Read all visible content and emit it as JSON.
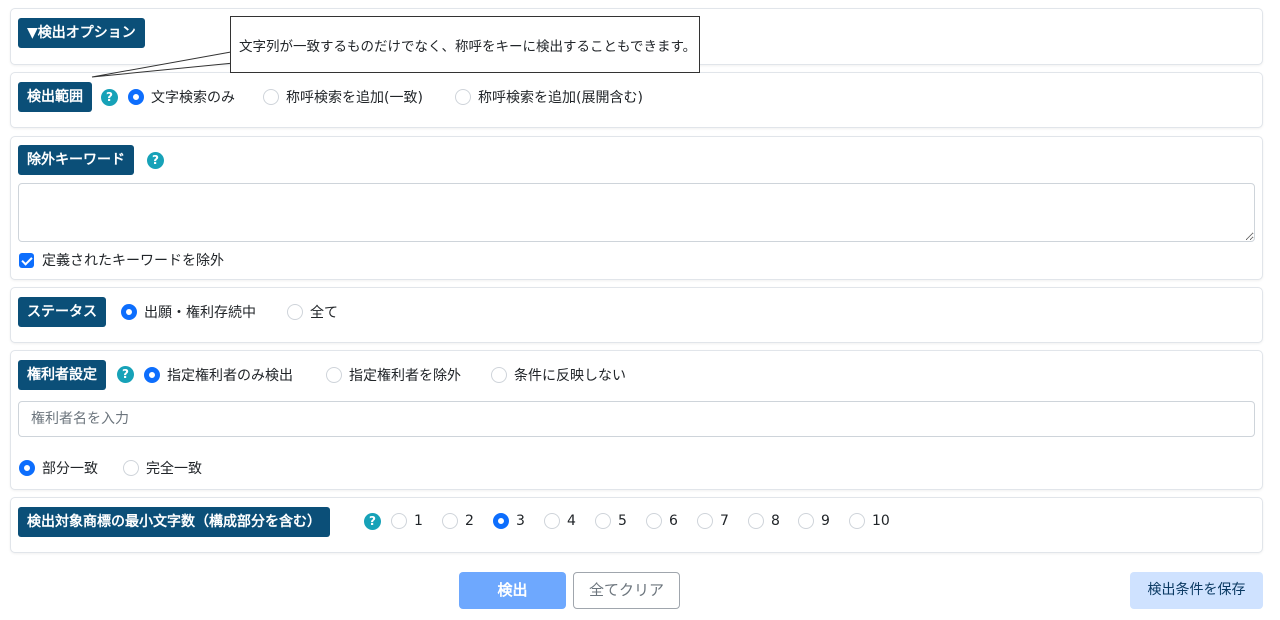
{
  "header": {
    "title": "▼検出オプション"
  },
  "tooltip": {
    "text": "文字列が一致するものだけでなく、称呼をキーに検出することもできます。"
  },
  "detect_range": {
    "label": "検出範囲",
    "help": "?",
    "options": [
      "文字検索のみ",
      "称呼検索を追加(一致)",
      "称呼検索を追加(展開含む)"
    ],
    "selected_index": 0
  },
  "exclude_keywords": {
    "label": "除外キーワード",
    "help": "?",
    "value": "",
    "checkbox_label": "定義されたキーワードを除外",
    "checked": true
  },
  "status": {
    "label": "ステータス",
    "options": [
      "出願・権利存続中",
      "全て"
    ],
    "selected_index": 0
  },
  "owner_settings": {
    "label": "権利者設定",
    "help": "?",
    "options": [
      "指定権利者のみ検出",
      "指定権利者を除外",
      "条件に反映しない"
    ],
    "selected_index": 0,
    "input_placeholder": "権利者名を入力",
    "input_value": "",
    "match_options": [
      "部分一致",
      "完全一致"
    ],
    "match_selected_index": 0
  },
  "min_chars": {
    "label": "検出対象商標の最小文字数（構成部分を含む）",
    "help": "?",
    "options": [
      "1",
      "2",
      "3",
      "4",
      "5",
      "6",
      "7",
      "8",
      "9",
      "10"
    ],
    "selected_index": 2
  },
  "buttons": {
    "search": "検出",
    "clear": "全てクリア",
    "save": "検出条件を保存"
  },
  "colors": {
    "badge": "#0b4f78",
    "radio_selected": "#0d6efd",
    "help_icon": "#17a2b8",
    "search_button": "#6ea8fe",
    "save_button": "#cfe2ff"
  }
}
